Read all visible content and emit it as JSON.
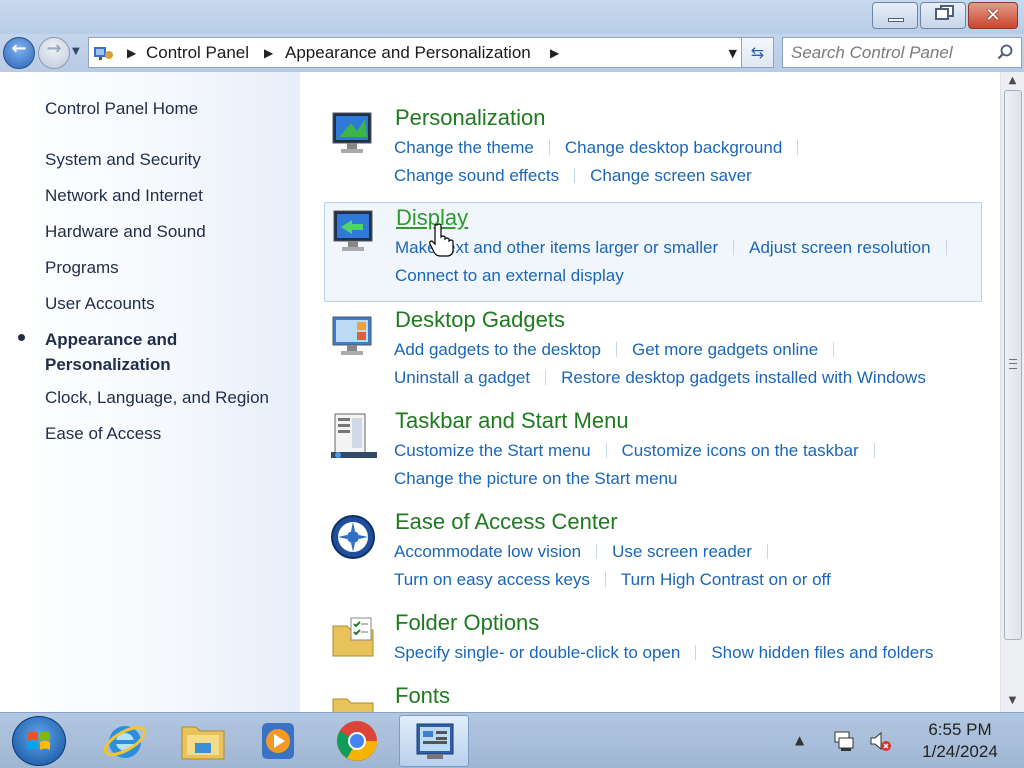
{
  "window": {
    "minimize_icon": "minimize-icon",
    "maximize_icon": "restore-icon",
    "close_icon": "close-icon",
    "close_glyph": "✕"
  },
  "navigation": {
    "back_glyph": "←",
    "forward_glyph": "→",
    "breadcrumbs": [
      "Control Panel",
      "Appearance and Personalization"
    ],
    "search_placeholder": "Search Control Panel"
  },
  "sidebar": {
    "home": "Control Panel Home",
    "items": [
      "System and Security",
      "Network and Internet",
      "Hardware and Sound",
      "Programs",
      "User Accounts",
      "Appearance and Personalization",
      "Clock, Language, and Region",
      "Ease of Access"
    ],
    "active_line1": "Appearance and",
    "active_line2": "Personalization"
  },
  "categories": [
    {
      "title": "Personalization",
      "icon": "personalization-icon",
      "row1": [
        "Change the theme",
        "Change desktop background"
      ],
      "row2": [
        "Change sound effects",
        "Change screen saver"
      ]
    },
    {
      "title": "Display",
      "icon": "display-icon",
      "row1": [
        "Make text and other items larger or smaller",
        "Adjust screen resolution"
      ],
      "row2": [
        "Connect to an external display"
      ]
    },
    {
      "title": "Desktop Gadgets",
      "icon": "gadgets-icon",
      "row1": [
        "Add gadgets to the desktop",
        "Get more gadgets online"
      ],
      "row2": [
        "Uninstall a gadget",
        "Restore desktop gadgets installed with Windows"
      ]
    },
    {
      "title": "Taskbar and Start Menu",
      "icon": "taskbar-icon",
      "row1": [
        "Customize the Start menu",
        "Customize icons on the taskbar"
      ],
      "row2": [
        "Change the picture on the Start menu"
      ]
    },
    {
      "title": "Ease of Access Center",
      "icon": "ease-of-access-icon",
      "row1": [
        "Accommodate low vision",
        "Use screen reader"
      ],
      "row2": [
        "Turn on easy access keys",
        "Turn High Contrast on or off"
      ]
    },
    {
      "title": "Folder Options",
      "icon": "folder-options-icon",
      "row1": [
        "Specify single- or double-click to open",
        "Show hidden files and folders"
      ],
      "row2": []
    },
    {
      "title": "Fonts",
      "icon": "fonts-icon",
      "row1": [],
      "row2": []
    }
  ],
  "taskbar": {
    "pinned": [
      "internet-explorer-icon",
      "file-explorer-icon",
      "media-player-icon",
      "chrome-icon",
      "control-panel-icon"
    ],
    "clock_time": "6:55 PM",
    "clock_date": "1/24/2024"
  },
  "colors": {
    "title_green": "#1e7a1e",
    "link_blue": "#1a66b8",
    "sidebar_text": "#1f2d4a"
  }
}
